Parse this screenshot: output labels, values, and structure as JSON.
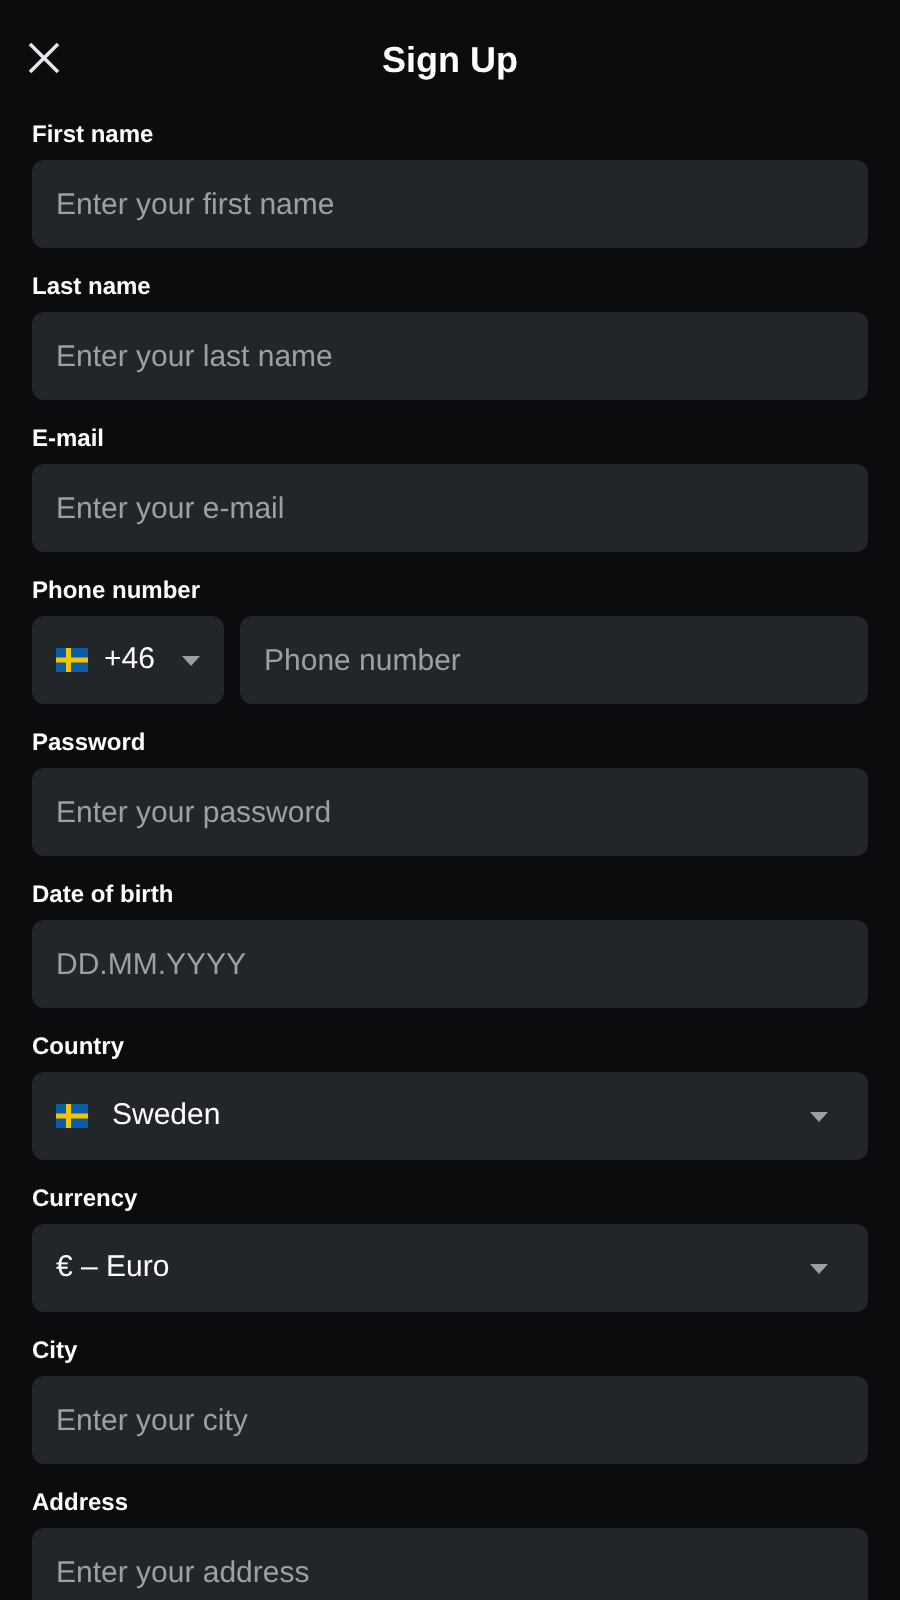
{
  "header": {
    "title": "Sign Up"
  },
  "fields": [
    {
      "kind": "text",
      "label": "First name",
      "placeholder": "Enter your first name"
    },
    {
      "kind": "text",
      "label": "Last name",
      "placeholder": "Enter your last name"
    },
    {
      "kind": "text",
      "label": "E-mail",
      "placeholder": "Enter your e-mail"
    },
    {
      "kind": "phone",
      "label": "Phone number",
      "code": "+46",
      "flag": true,
      "placeholder": "Phone number"
    },
    {
      "kind": "text",
      "label": "Password",
      "placeholder": "Enter your password"
    },
    {
      "kind": "text",
      "label": "Date of birth",
      "placeholder": "DD.MM.YYYY"
    },
    {
      "kind": "select",
      "label": "Country",
      "value": "Sweden",
      "flag": true
    },
    {
      "kind": "select",
      "label": "Currency",
      "value": "€ – Euro",
      "flag": false
    },
    {
      "kind": "text",
      "label": "City",
      "placeholder": "Enter your city"
    },
    {
      "kind": "text",
      "label": "Address",
      "placeholder": "Enter your address"
    }
  ]
}
